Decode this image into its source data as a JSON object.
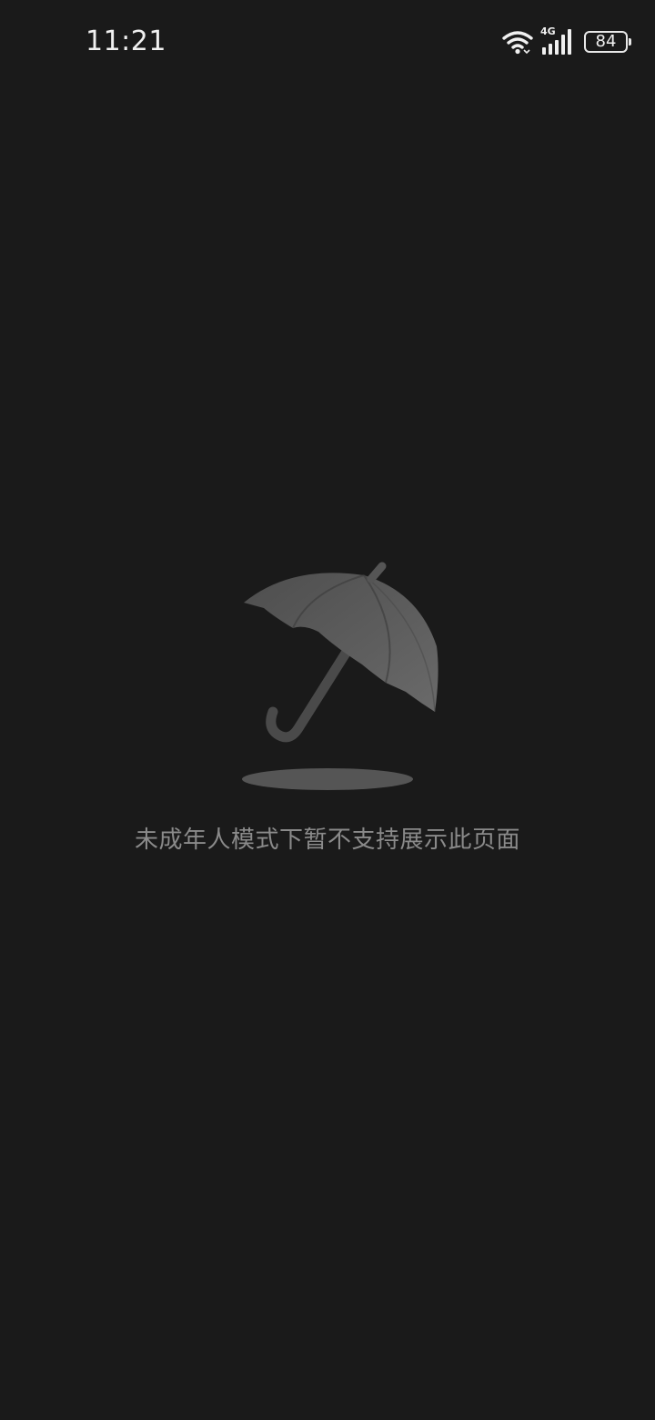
{
  "status_bar": {
    "time": "11:21",
    "network_label": "4G",
    "battery_level": "84",
    "icons": [
      "wifi-icon",
      "cellular-signal-icon",
      "battery-icon"
    ]
  },
  "empty_state": {
    "illustration": "umbrella-icon",
    "message": "未成年人模式下暂不支持展示此页面"
  },
  "colors": {
    "background": "#1a1a1a",
    "message_text": "#8a8a8a",
    "illustration": "#5a5a5a"
  }
}
